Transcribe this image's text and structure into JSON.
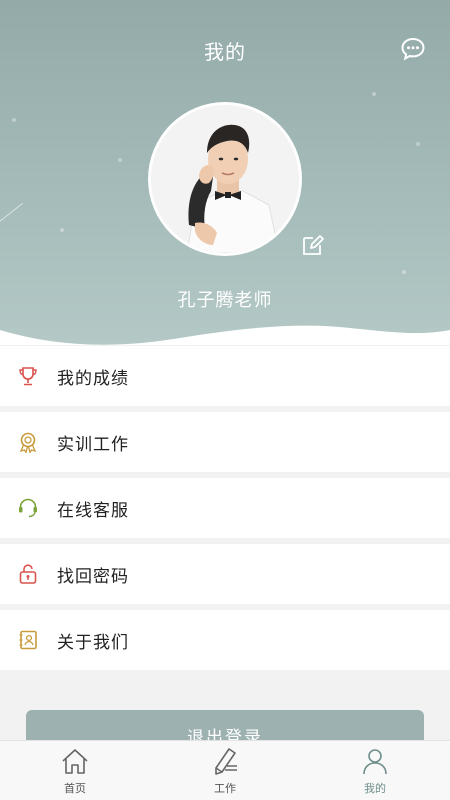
{
  "header": {
    "title": "我的"
  },
  "profile": {
    "name": "孔子腾老师"
  },
  "menu": [
    {
      "label": "我的成绩",
      "icon": "trophy-icon"
    },
    {
      "label": "实训工作",
      "icon": "medal-icon"
    },
    {
      "label": "在线客服",
      "icon": "headset-icon"
    },
    {
      "label": "找回密码",
      "icon": "unlock-icon"
    },
    {
      "label": "关于我们",
      "icon": "contact-card-icon"
    }
  ],
  "logout_label": "退出登录",
  "tabbar": [
    {
      "label": "首页",
      "icon": "home-icon"
    },
    {
      "label": "工作",
      "icon": "pen-icon"
    },
    {
      "label": "我的",
      "icon": "user-icon",
      "active": true
    }
  ],
  "colors": {
    "accent": "#9db1b1",
    "header": "#a4bbb9",
    "active_tab": "#6e8f8c"
  }
}
